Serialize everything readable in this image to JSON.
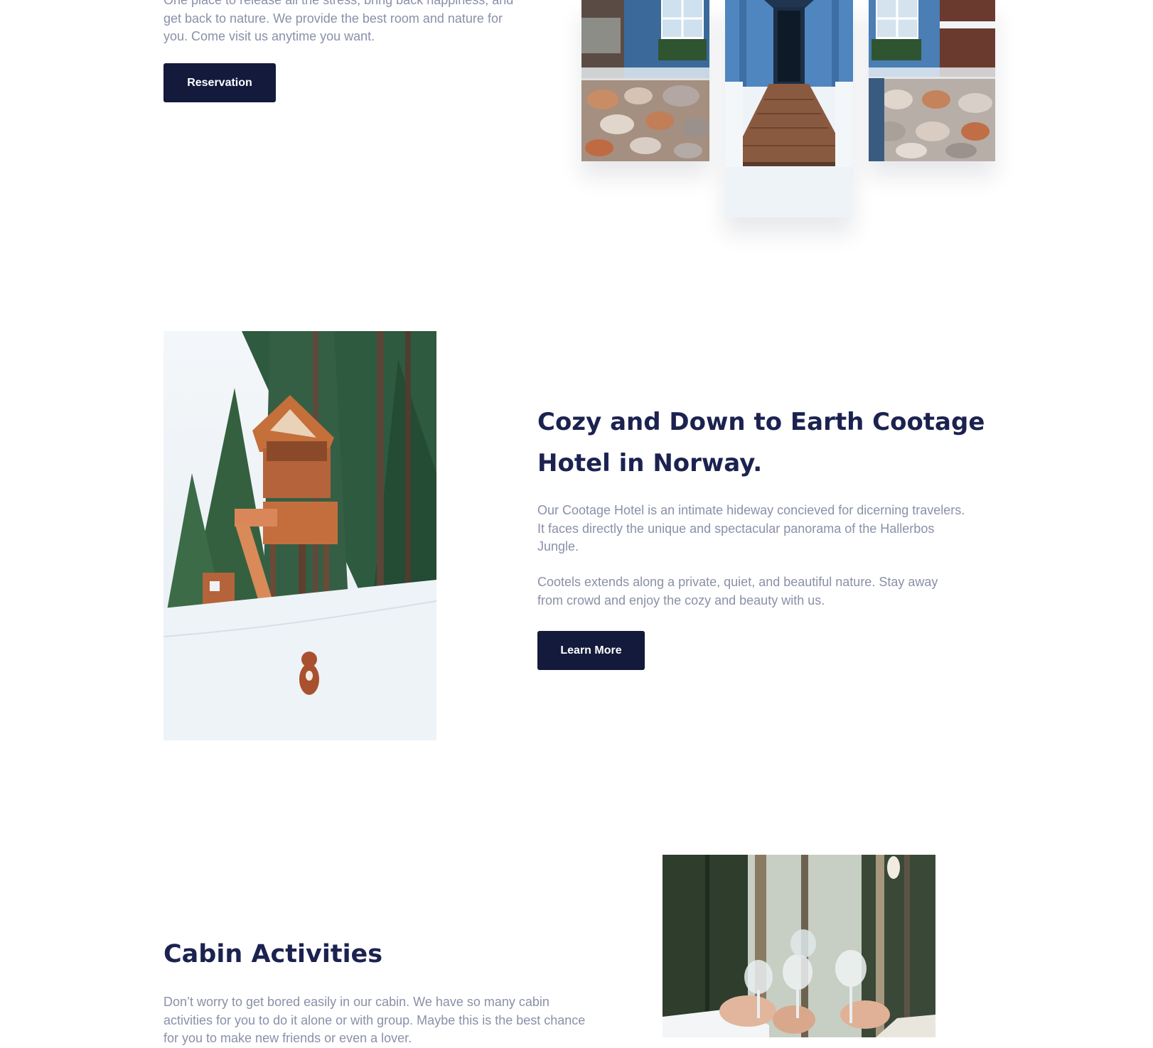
{
  "hero": {
    "text_line_1": "One place to release all the stress, bring back happiness, and",
    "text_line_2": "get back to nature. We provide the best room and nature for",
    "text_line_3": "you. Come visit us anytime you want.",
    "button_label": "Reservation"
  },
  "cootage": {
    "title_line_1": "Cozy and Down to Earth Cootage",
    "title_line_2": "Hotel in Norway.",
    "paragraph_1_line_1": "Our Cootage Hotel is an intimate hideway concieved for dicerning travelers.",
    "paragraph_1_line_2": "It faces directly the unique and spectacular panorama of the Hallerbos",
    "paragraph_1_line_3": "Jungle.",
    "paragraph_2_line_1": "Cootels extends along a private, quiet, and beautiful nature. Stay away",
    "paragraph_2_line_2": "from crowd and enjoy the cozy and beauty with us.",
    "button_label": "Learn More"
  },
  "activities": {
    "title": "Cabin Activities",
    "text_line_1": "Don’t worry to get bored easily in our cabin. We have so many cabin",
    "text_line_2": "activities for you to do it alone or with group. Maybe this is the best chance",
    "text_line_3": "for you to make new friends or even a lover."
  },
  "colors": {
    "navy": "#141a3b",
    "heading": "#1c2250",
    "body_text": "#8a90a8"
  }
}
